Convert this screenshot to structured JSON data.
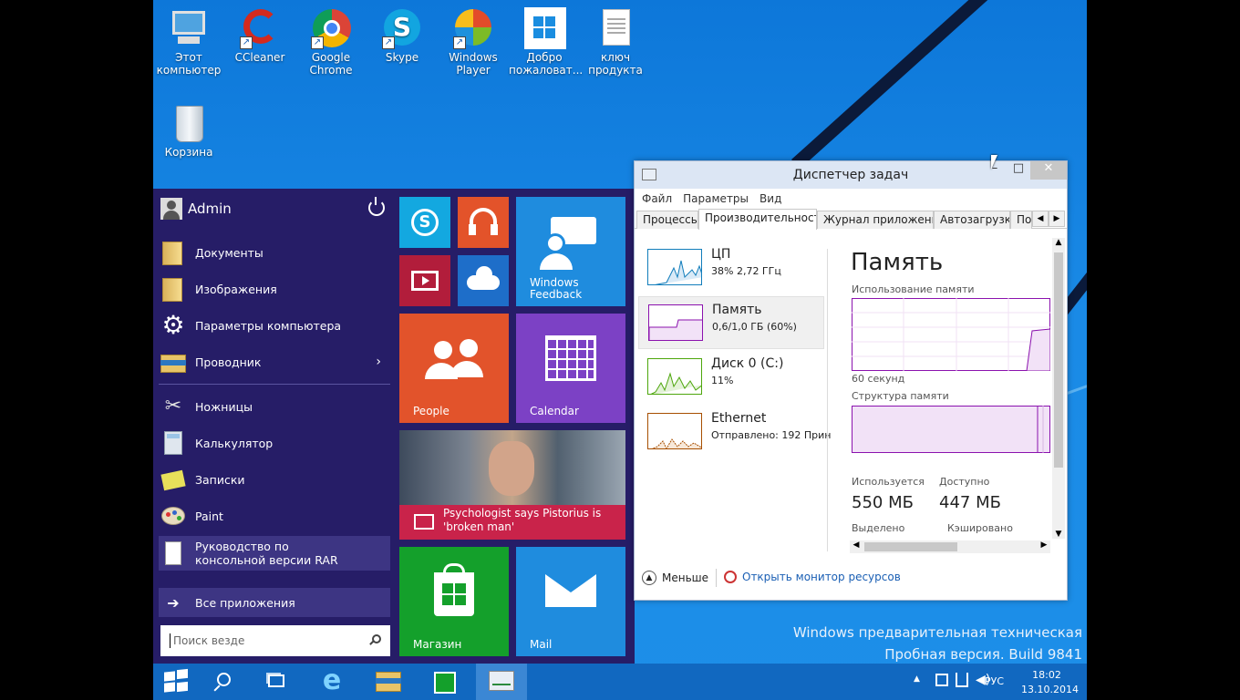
{
  "desktop": {
    "icons": [
      {
        "label": "Этот компьютер",
        "icon": "computer-icon"
      },
      {
        "label": "CCleaner",
        "icon": "ccleaner-icon"
      },
      {
        "label": "Google Chrome",
        "icon": "chrome-icon"
      },
      {
        "label": "Skype",
        "icon": "skype-icon"
      },
      {
        "label": "Windows Player",
        "icon": "media-player-icon"
      },
      {
        "label": "Добро пожаловат...",
        "icon": "windows-icon"
      },
      {
        "label": "ключ продукта",
        "icon": "document-icon"
      },
      {
        "label": "Корзина",
        "icon": "recycle-bin-icon"
      }
    ]
  },
  "start_menu": {
    "user": "Admin",
    "places": [
      {
        "label": "Документы",
        "icon": "folder-icon"
      },
      {
        "label": "Изображения",
        "icon": "folder-icon"
      },
      {
        "label": "Параметры компьютера",
        "icon": "gear-icon"
      },
      {
        "label": "Проводник",
        "icon": "explorer-icon"
      }
    ],
    "apps": [
      {
        "label": "Ножницы",
        "icon": "scissors-icon"
      },
      {
        "label": "Калькулятор",
        "icon": "calculator-icon"
      },
      {
        "label": "Записки",
        "icon": "sticky-notes-icon"
      },
      {
        "label": "Paint",
        "icon": "paint-icon"
      },
      {
        "label": "Руководство по консольной версии RAR",
        "icon": "document-icon"
      }
    ],
    "all_apps": "Все приложения",
    "search_placeholder": "Поиск везде",
    "tiles": {
      "feedback": "Windows Feedback",
      "people": "People",
      "calendar": "Calendar",
      "news": "Psychologist says Pistorius is 'broken man'",
      "store": "Магазин",
      "mail": "Mail"
    }
  },
  "task_manager": {
    "title": "Диспетчер задач",
    "menu": [
      "Файл",
      "Параметры",
      "Вид"
    ],
    "tabs": [
      "Процессы",
      "Производительность",
      "Журнал приложений",
      "Автозагрузка",
      "По..."
    ],
    "active_tab": "Производительность",
    "resources": [
      {
        "name": "ЦП",
        "value": "38% 2,72 ГГц",
        "color": "#117dbb"
      },
      {
        "name": "Память",
        "value": "0,6/1,0 ГБ (60%)",
        "color": "#8b12ae"
      },
      {
        "name": "Диск 0 (C:)",
        "value": "11%",
        "color": "#4da60c"
      },
      {
        "name": "Ethernet",
        "value": "Отправлено: 192 Прин",
        "color": "#a74f01"
      }
    ],
    "memory": {
      "heading": "Память",
      "usage_label": "Использование памяти",
      "time_label": "60 секунд",
      "structure_label": "Структура памяти",
      "in_use_label": "Используется",
      "in_use_value": "550 МБ",
      "available_label": "Доступно",
      "available_value": "447 МБ",
      "committed_label": "Выделено",
      "cached_label": "Кэшировано"
    },
    "less_label": "Меньше",
    "monitor_link": "Открыть монитор ресурсов"
  },
  "watermark": {
    "line1": "Windows предварительная техническая",
    "line2": "Пробная версия. Build 9841"
  },
  "tray": {
    "language": "РУС",
    "time": "18:02",
    "date": "13.10.2014"
  }
}
